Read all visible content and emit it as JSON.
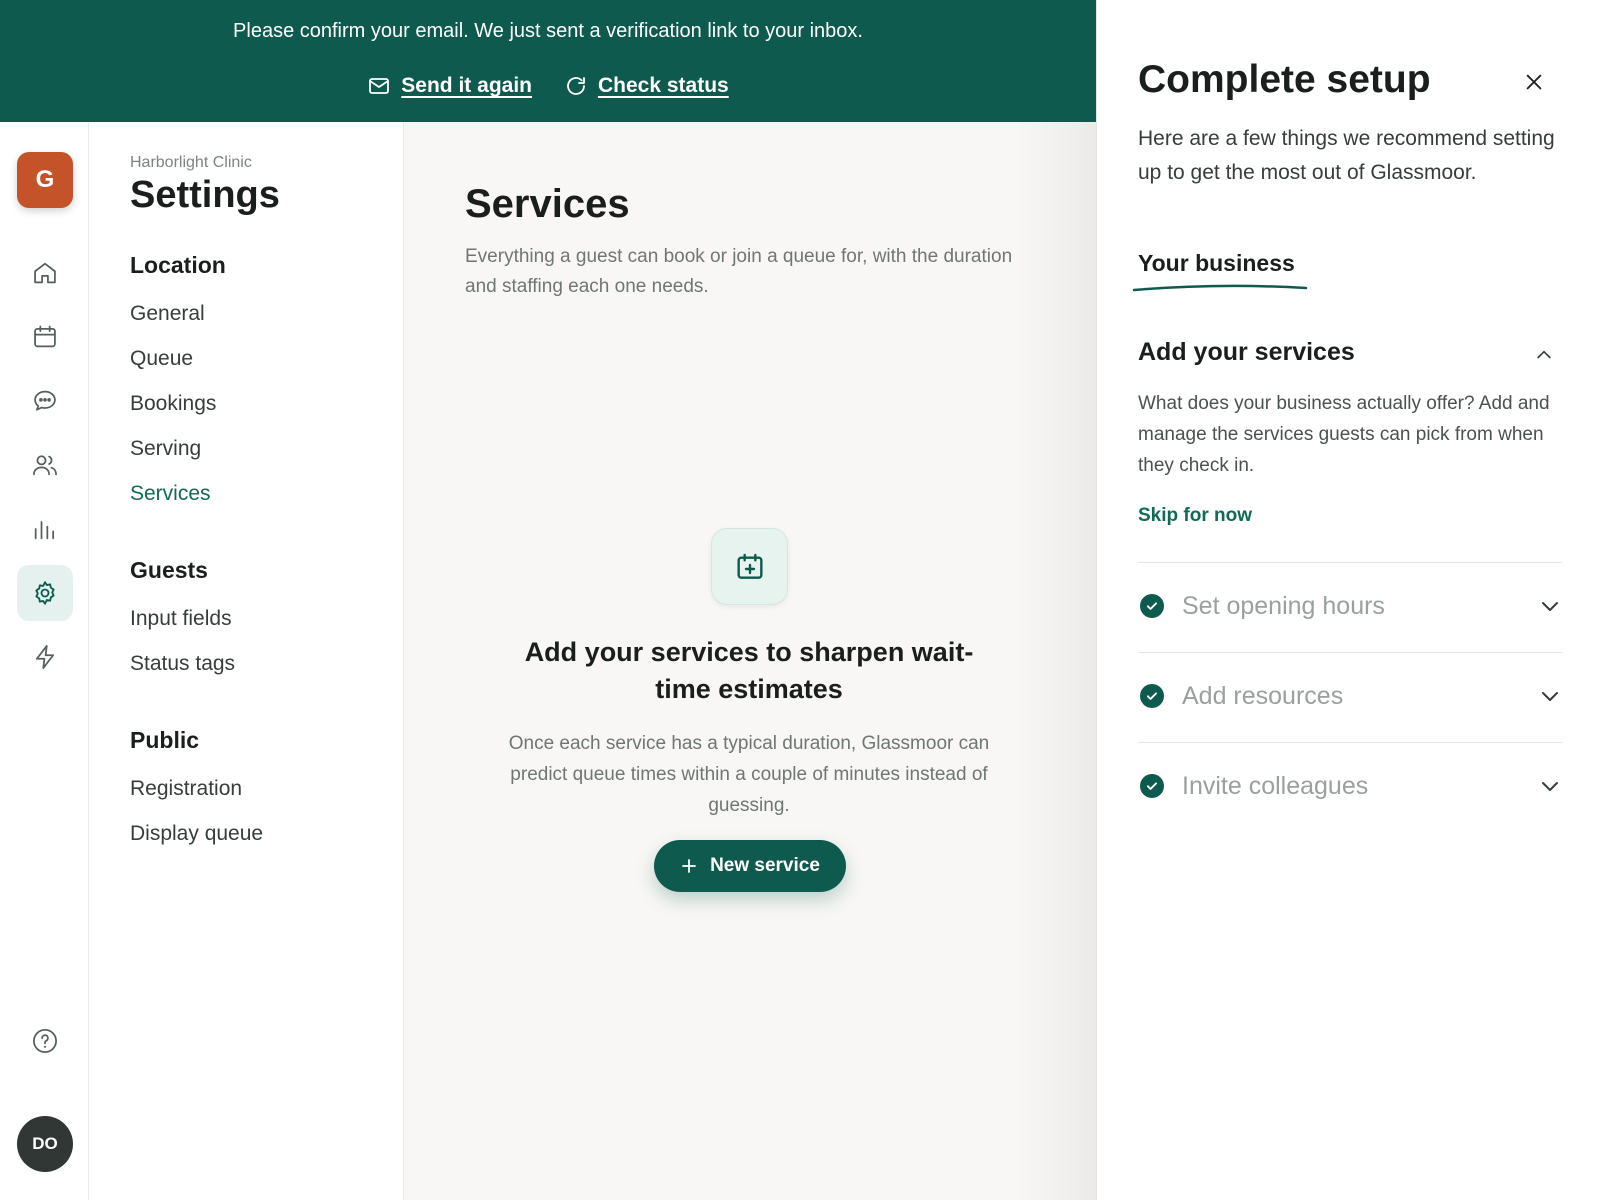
{
  "banner": {
    "message": "Please confirm your email. We just sent a verification link to your inbox.",
    "send_again": "Send it again",
    "check_status": "Check status"
  },
  "rail": {
    "logo_letter": "G",
    "items": [
      {
        "icon": "home-icon"
      },
      {
        "icon": "calendar-icon"
      },
      {
        "icon": "chat-icon"
      },
      {
        "icon": "users-icon"
      },
      {
        "icon": "analytics-icon"
      },
      {
        "icon": "gear-icon",
        "active": true
      },
      {
        "icon": "lightning-icon"
      }
    ],
    "help_icon": "help-icon",
    "avatar_initials": "DO"
  },
  "settings_nav": {
    "org": "Harborlight Clinic",
    "title": "Settings",
    "sections": [
      {
        "label": "Location",
        "items": [
          "General",
          "Queue",
          "Bookings",
          "Serving",
          "Services"
        ]
      },
      {
        "label": "Guests",
        "items": [
          "Input fields",
          "Status tags"
        ]
      },
      {
        "label": "Public",
        "items": [
          "Registration",
          "Display queue"
        ]
      }
    ],
    "active_item": "Services"
  },
  "main": {
    "title": "Services",
    "description": "Everything a guest can book or join a queue for, with the duration and staffing each one needs.",
    "empty_icon": "calendar-plus-icon",
    "empty_title": "Add your services to sharpen wait-time estimates",
    "empty_description": "Once each service has a typical duration, Glassmoor can predict queue times within a couple of minutes instead of guessing.",
    "new_service_label": "New service"
  },
  "panel": {
    "title": "Complete setup",
    "description": "Here are a few things we recommend setting up to get the most out of Glassmoor.",
    "tab": "Your business",
    "open_step": {
      "title": "Add your services",
      "description": "What does your business actually offer? Add and manage the services guests can pick from when they check in.",
      "skip": "Skip for now"
    },
    "completed_steps": [
      "Set opening hours",
      "Add resources",
      "Invite colleagues"
    ]
  },
  "colors": {
    "brand": "#0f5a4e",
    "accent_text": "#0f6b57",
    "logo": "#c4532a"
  }
}
